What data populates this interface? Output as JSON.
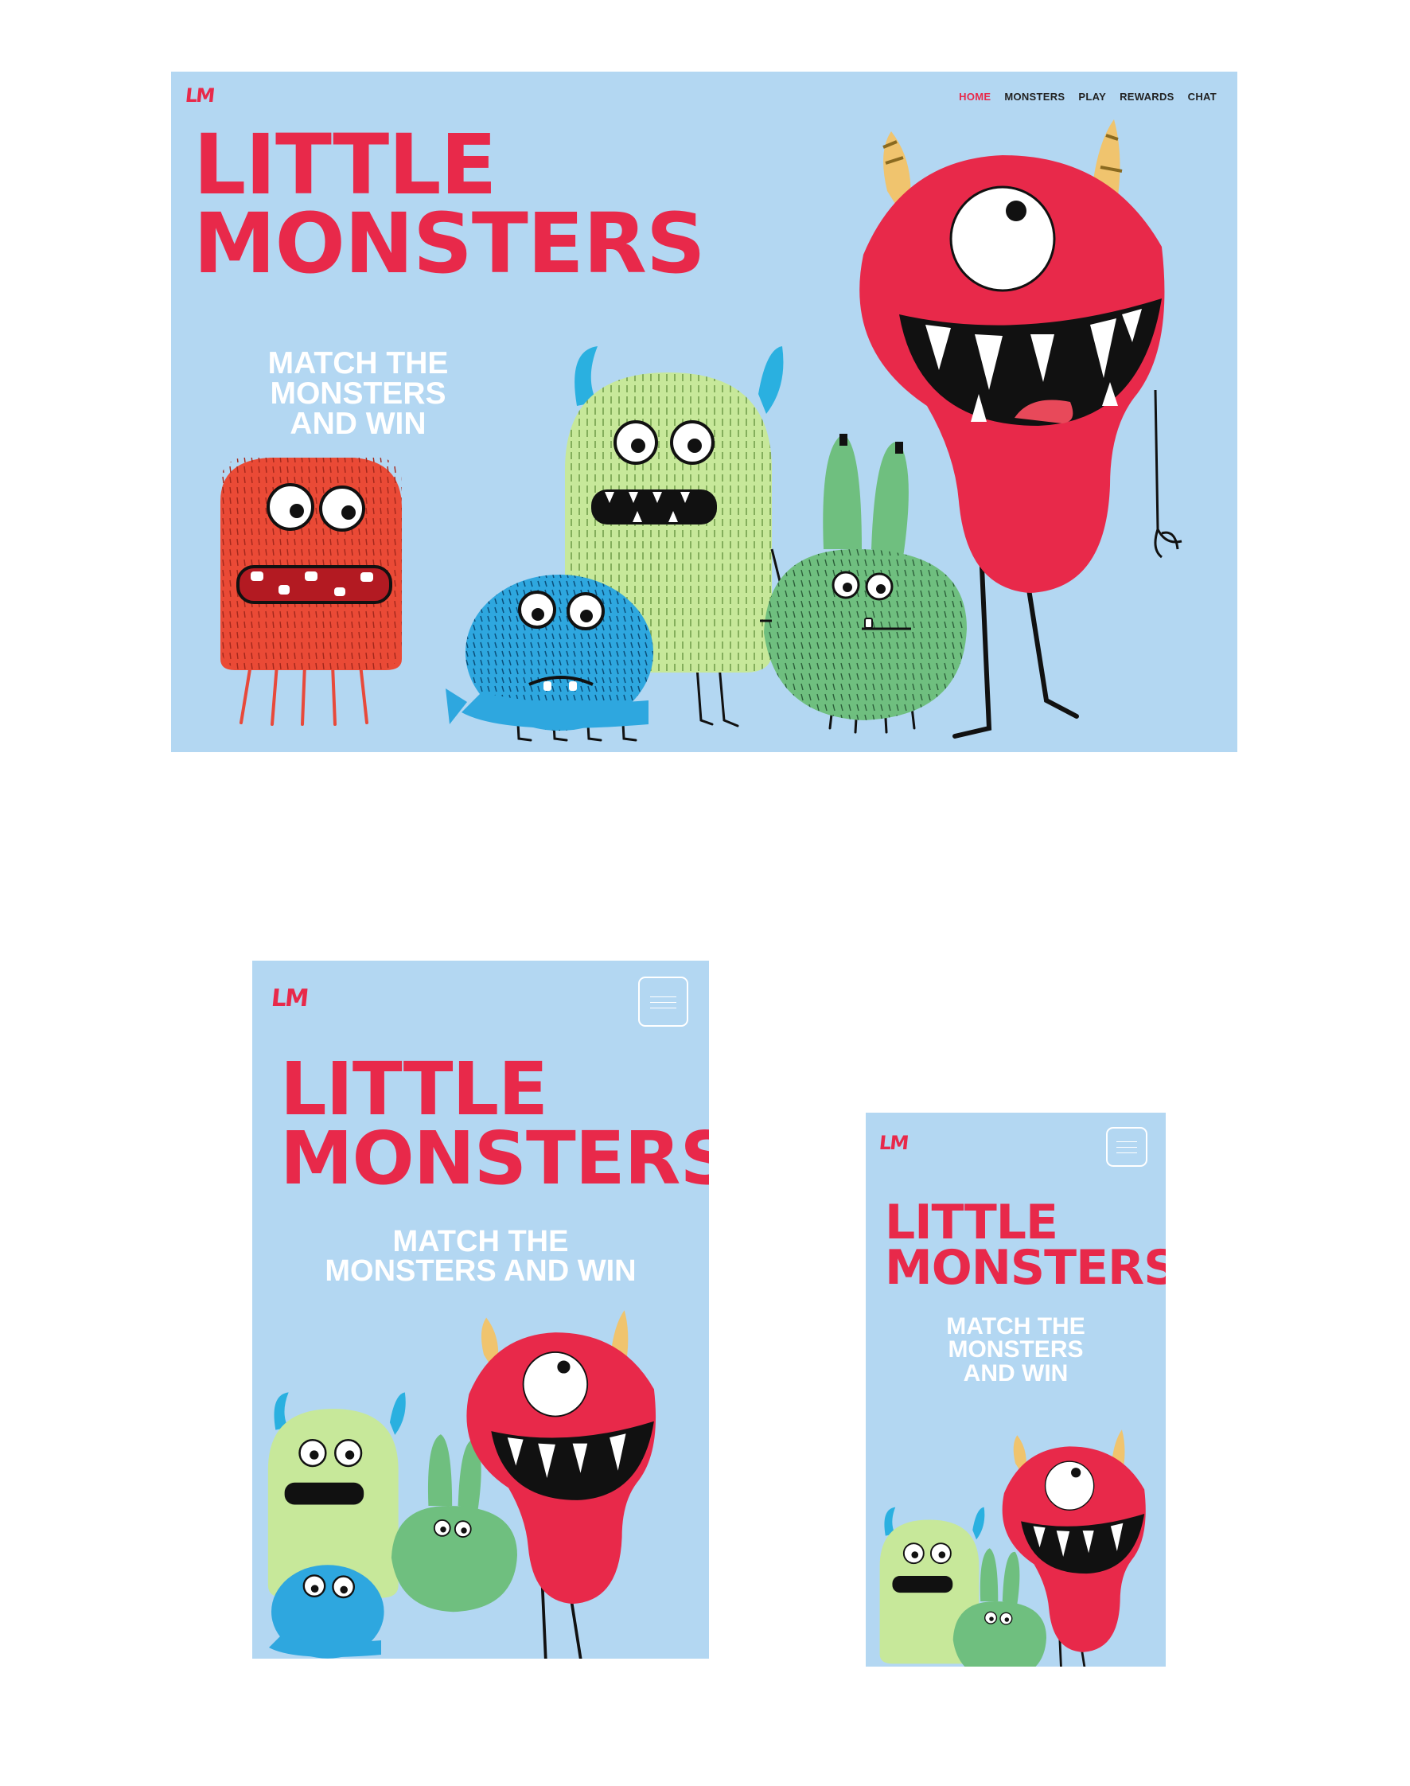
{
  "brand": {
    "logo_text": "LM",
    "title_line1": "Little",
    "title_line2": "Monsters",
    "accent": "#e8294a",
    "background": "#b3d7f2"
  },
  "desktop": {
    "nav": [
      {
        "label": "HOME",
        "active": true
      },
      {
        "label": "MONSTERS"
      },
      {
        "label": "PLAY"
      },
      {
        "label": "REWARDS"
      },
      {
        "label": "CHAT"
      }
    ],
    "tagline_lines": [
      "MATCH THE",
      "MONSTERS",
      "AND WIN"
    ]
  },
  "tablet": {
    "tagline_lines": [
      "MATCH THE",
      "MONSTERS AND WIN"
    ],
    "menu_icon": "hamburger-menu-icon"
  },
  "mobile": {
    "tagline_lines": [
      "MATCH THE",
      "MONSTERS",
      "AND WIN"
    ],
    "menu_icon": "hamburger-menu-icon"
  },
  "monsters": [
    "red-square-monster",
    "blue-fuzzy-monster",
    "light-green-monster",
    "green-bunny-monster",
    "red-cyclops-monster"
  ]
}
